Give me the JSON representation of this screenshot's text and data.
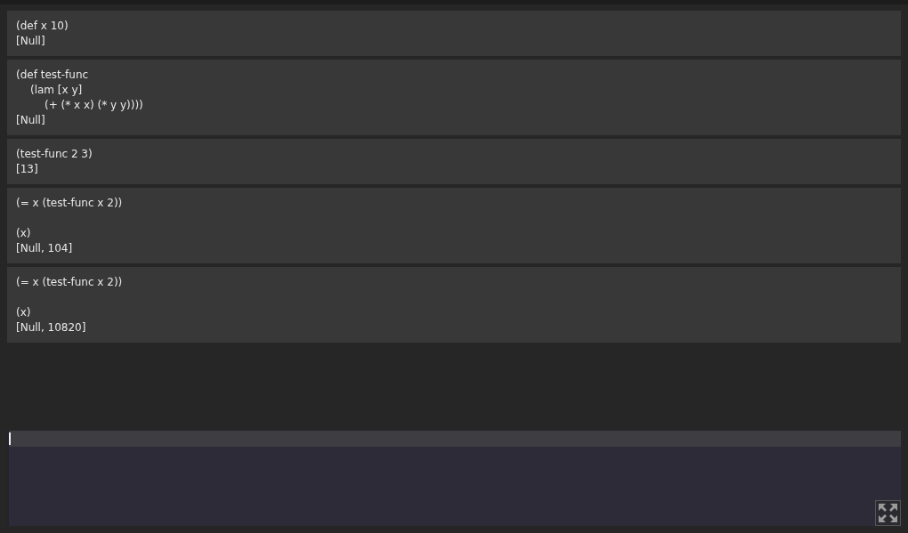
{
  "cells": [
    {
      "input": [
        {
          "text": "(def x 10)"
        }
      ],
      "result": "[Null]"
    },
    {
      "input": [
        {
          "text": "(def test-func",
          "children": [
            {
              "text": "(lam [x y]",
              "children": [
                {
                  "text": "(+ (* x x) (* y y))))"
                }
              ]
            }
          ]
        }
      ],
      "result": "[Null]"
    },
    {
      "input": [
        {
          "text": "(test-func 2 3)"
        }
      ],
      "result": "[13]"
    },
    {
      "input": [
        {
          "text": "(= x (test-func x 2))"
        }
      ],
      "printed": "(x)",
      "result": "[Null, 104]"
    },
    {
      "input": [
        {
          "text": "(= x (test-func x 2))"
        }
      ],
      "printed": "(x)",
      "result": "[Null, 10820]"
    }
  ],
  "editor": {
    "focused": true
  }
}
